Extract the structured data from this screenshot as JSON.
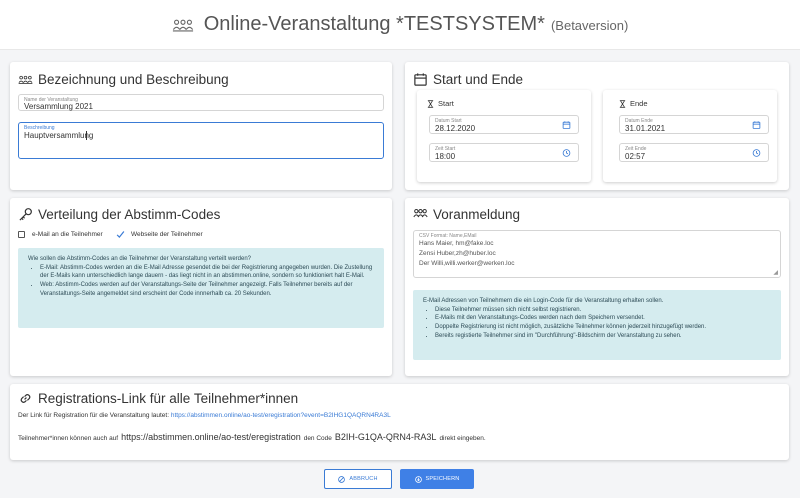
{
  "header": {
    "title": "Online-Veranstaltung *TESTSYSTEM*",
    "beta": "(Betaversion)"
  },
  "bezeichnung": {
    "title": "Bezeichnung und Beschreibung",
    "name_label": "Name der Veranstaltung",
    "name_value": "Versammlung 2021",
    "desc_label": "Beschreibung",
    "desc_value": "Hauptversammlung"
  },
  "start_ende": {
    "title": "Start und Ende",
    "start": {
      "title": "Start",
      "date_label": "Datum Start",
      "date_value": "28.12.2020",
      "time_label": "Zeit Start",
      "time_value": "18:00"
    },
    "ende": {
      "title": "Ende",
      "date_label": "Datum Ende",
      "date_value": "31.01.2021",
      "time_label": "Zeit Ende",
      "time_value": "02:57"
    }
  },
  "verteilung": {
    "title": "Verteilung der Abstimm-Codes",
    "option_email": "e-Mail an die Teilnehmer",
    "option_email_checked": false,
    "option_web": "Webseite der Teilnehmer",
    "option_web_checked": true,
    "info_intro": "Wie sollen die Abstimm-Codes an die Teilnehmer der Veranstaltung verteilt werden?",
    "info_items": [
      "E-Mail: Abstimm-Codes werden an die E-Mail Adresse gesendet die bei der Registrierung angegeben wurden. Die Zustellung der E-Mails kann unterschiedlich lange dauern - das liegt nicht in an abstimmen.online, sondern so funktioniert halt E-Mail.",
      "Web: Abstimm-Codes werden auf der Veranstaltungs-Seite der Teilnehmer angezeigt. Falls Teilnehmer bereits auf der Veranstaltungs-Seite angemeldet sind erscheint der Code innnerhalb ca. 20 Sekunden."
    ]
  },
  "voranmeldung": {
    "title": "Voranmeldung",
    "csv_label": "CSV Format: Name,EMail",
    "csv_lines": [
      "Hans Maier, hm@fake.loc",
      "Zensi Huber,zh@huber.loc",
      "Der Willi,willi.werker@werken.loc"
    ],
    "info_intro": "E-Mail Adressen von Teilnehmern die ein Login-Code für die Veranstaltung erhalten sollen.",
    "info_items": [
      "Diese Teilnehmer müssen sich nicht selbst registrieren.",
      "E-Mails mit den Veranstaltungs-Codes werden nach dem Speichern versendet.",
      "Doppelte Registrierung ist nicht möglich, zusätzliche Teilnehmer können jederzeit hinzugefügt werden.",
      "Bereits registierte Teilnehmer sind im \"Durchführung\"-Bildschirm der Veranstaltung zu sehen."
    ]
  },
  "registration": {
    "title": "Registrations-Link für alle Teilnehmer*innen",
    "link_prefix": "Der Link für Registration für die Veranstaltung lautet:",
    "link_url": "https://abstimmen.online/ao-test/eregistration?event=B2IHG1QAQRN4RA3L",
    "text_before": "Teilnehmer*innen können auch auf",
    "site": "https://abstimmen.online/ao-test/eregistration",
    "text_mid": "den Code",
    "code": "B2IH-G1QA-QRN4-RA3L",
    "text_after": "direkt eingeben."
  },
  "buttons": {
    "cancel": "ABBRUCH",
    "save": "SPEICHERN"
  },
  "colors": {
    "accent": "#3a7bd5",
    "info_bg": "#d5ecef",
    "page_bg": "#f4f5f7"
  }
}
